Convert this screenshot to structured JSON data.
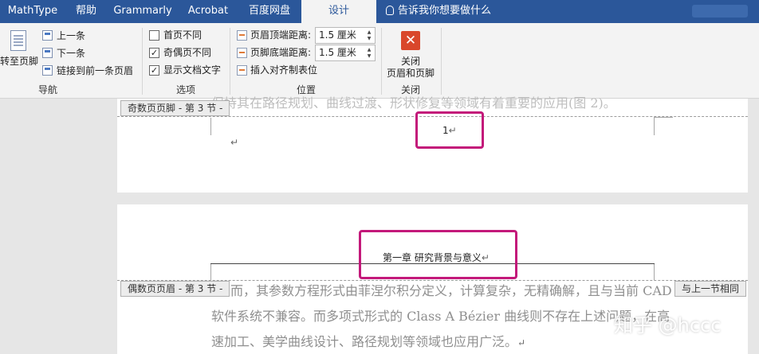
{
  "tabs": [
    {
      "label": "MathType"
    },
    {
      "label": "帮助"
    },
    {
      "label": "Grammarly"
    },
    {
      "label": "Acrobat"
    },
    {
      "label": "百度网盘"
    },
    {
      "label": "设计",
      "active": true
    }
  ],
  "tellme": {
    "label": "告诉我你想要做什么"
  },
  "ribbon": {
    "navigation": {
      "goto_footer": "转至页脚",
      "previous": "上一条",
      "next": "下一条",
      "link_previous": "链接到前一条页眉",
      "group_label": "导航"
    },
    "options": {
      "different_first_page": {
        "label": "首页不同",
        "checked": false
      },
      "different_odd_even": {
        "label": "奇偶页不同",
        "checked": true
      },
      "show_document_text": {
        "label": "显示文档文字",
        "checked": true
      },
      "group_label": "选项"
    },
    "position": {
      "header_from_top_label": "页眉顶端距离:",
      "header_from_top_value": "1.5 厘米",
      "footer_from_bottom_label": "页脚底端距离:",
      "footer_from_bottom_value": "1.5 厘米",
      "insert_alignment_tab": "插入对齐制表位",
      "group_label": "位置"
    },
    "close": {
      "button_line1": "关闭",
      "button_line2": "页眉和页脚",
      "group_label": "关闭"
    }
  },
  "document": {
    "page1": {
      "top_text": "保持其在路径规划、曲线过渡、形状修复等领域有着重要的应用(图 2)。",
      "footer_tag": "奇数页页脚 - 第 3 节 -",
      "page_number": "1",
      "paragraph_mark": "↵"
    },
    "page2": {
      "header_title": "第一章  研究背景与意义",
      "header_tag": "偶数页页眉 - 第 3 节 -",
      "same_as_previous": "与上一节相同",
      "body_line1": "而，其参数方程形式由菲涅尔积分定义，计算复杂，无精确解，且与当前 CAD",
      "body_line2": "软件系统不兼容。而多项式形式的 Class A Bézier 曲线则不存在上述问题，在高",
      "body_line3": "速加工、美学曲线设计、路径规划等领域也应用广泛。",
      "paragraph_mark": "↵"
    }
  },
  "watermark": "知乎 @hccc",
  "colors": {
    "tabbar": "#2b579a",
    "ribbon": "#f3f3f3",
    "highlight": "#c3197a",
    "close_button": "#d9472b"
  }
}
